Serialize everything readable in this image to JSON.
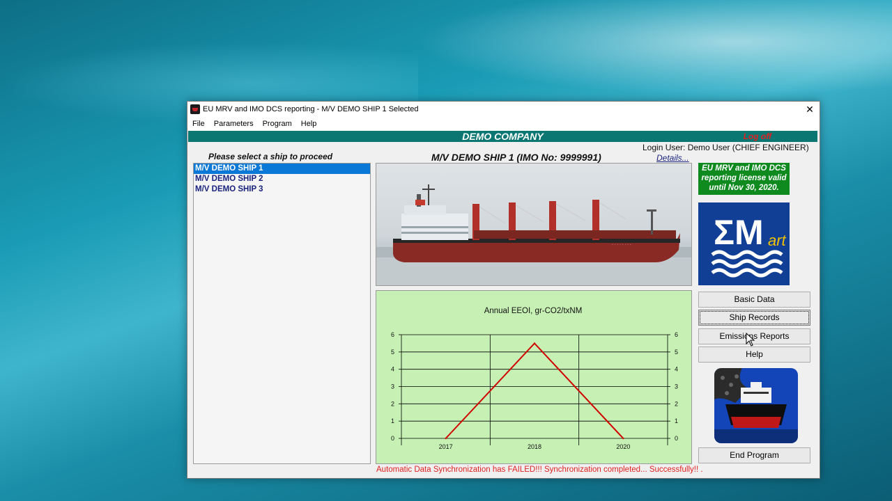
{
  "window": {
    "title": "EU MRV and IMO DCS reporting - M/V DEMO SHIP 1 Selected",
    "close": "✕"
  },
  "menu": [
    "File",
    "Parameters",
    "Program",
    "Help"
  ],
  "header": {
    "company": "DEMO COMPANY",
    "logoff": "Log off"
  },
  "ship_panel": {
    "prompt": "Please select a ship to proceed",
    "ships": [
      "M/V DEMO SHIP 1",
      "M/V DEMO SHIP 2",
      "M/V DEMO SHIP 3"
    ],
    "selected_index": 0
  },
  "main": {
    "ship_title": "M/V DEMO SHIP 1 (IMO No: 9999991)",
    "login_user": "Login User: Demo User (CHIEF ENGINEER)",
    "details_link": "Details..."
  },
  "license": {
    "text": "EU MRV and IMO DCS reporting  license valid until Nov 30, 2020."
  },
  "buttons": {
    "basic_data": "Basic Data",
    "ship_records": "Ship Records",
    "emissions_reports": "Emissions Reports",
    "help": "Help",
    "end_program": "End Program"
  },
  "status_text": "Automatic Data Synchronization has FAILED!!! Synchronization completed... Successfully!! .",
  "colors": {
    "company_bar": "#0b7773",
    "license_bg": "#0e8a1f",
    "chart_bg": "#c6f0b4",
    "chart_line": "#d10000",
    "error_text": "#e02020"
  },
  "chart_data": {
    "type": "line",
    "title": "Annual EEOI, gr-CO2/txNM",
    "categories": [
      "2017",
      "2018",
      "2020"
    ],
    "series": [
      {
        "values": [
          0,
          5.5,
          0
        ]
      }
    ],
    "ylim": [
      0,
      6
    ],
    "yticks": [
      0,
      1,
      2,
      3,
      4,
      5,
      6
    ],
    "grid": true,
    "right_axis_mirror": true
  }
}
